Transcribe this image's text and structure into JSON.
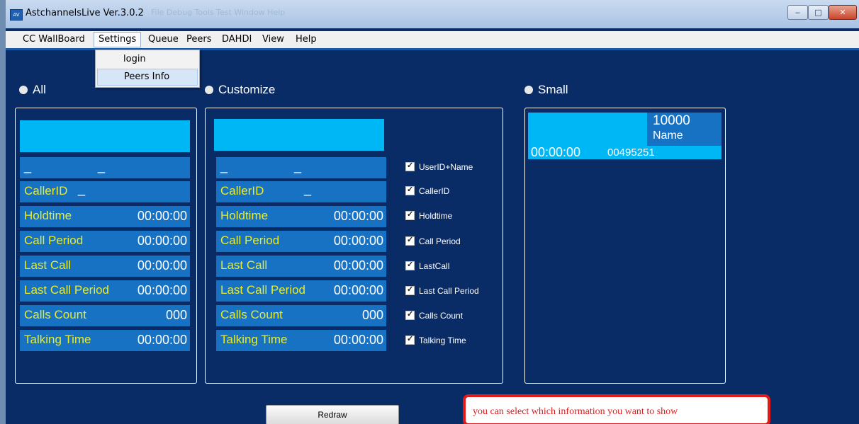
{
  "window": {
    "title": "AstchannelsLive Ver.3.0.2",
    "app_icon": "app-icon",
    "ghost_menu": "File   Debug   Tools   Test   Window   Help"
  },
  "menu": {
    "items": [
      "CC WallBoard",
      "Settings",
      "Queue",
      "Peers",
      "DAHDI",
      "View",
      "Help"
    ],
    "settings_dropdown": [
      "login",
      "Peers Info"
    ]
  },
  "modes": {
    "all": "All",
    "customize": "Customize",
    "small": "Small"
  },
  "fields": {
    "dash": "_",
    "callerid": "CallerID",
    "holdtime": "Holdtime",
    "call_period": "Call Period",
    "last_call": "Last Call",
    "last_call_period": "Last Call Period",
    "calls_count": "Calls Count",
    "talking_time": "Talking Time",
    "time_value": "00:00:00",
    "count_value": "000"
  },
  "checkboxes": [
    "UserID+Name",
    "CallerID",
    "Holdtime",
    "Call Period",
    "LastCall",
    "Last Call Period",
    "Calls Count",
    "Talking Time"
  ],
  "small": {
    "userid": "10000",
    "name": "Name",
    "time": "00:00:00",
    "number": "00495251"
  },
  "buttons": {
    "redraw": "Redraw"
  },
  "callout": "you can select which information you want to show",
  "colors": {
    "background": "#0a2c66",
    "box": "#00b7f5",
    "row": "#1872c4",
    "label": "#e8eb2a",
    "callout_border": "#e41a1a"
  }
}
